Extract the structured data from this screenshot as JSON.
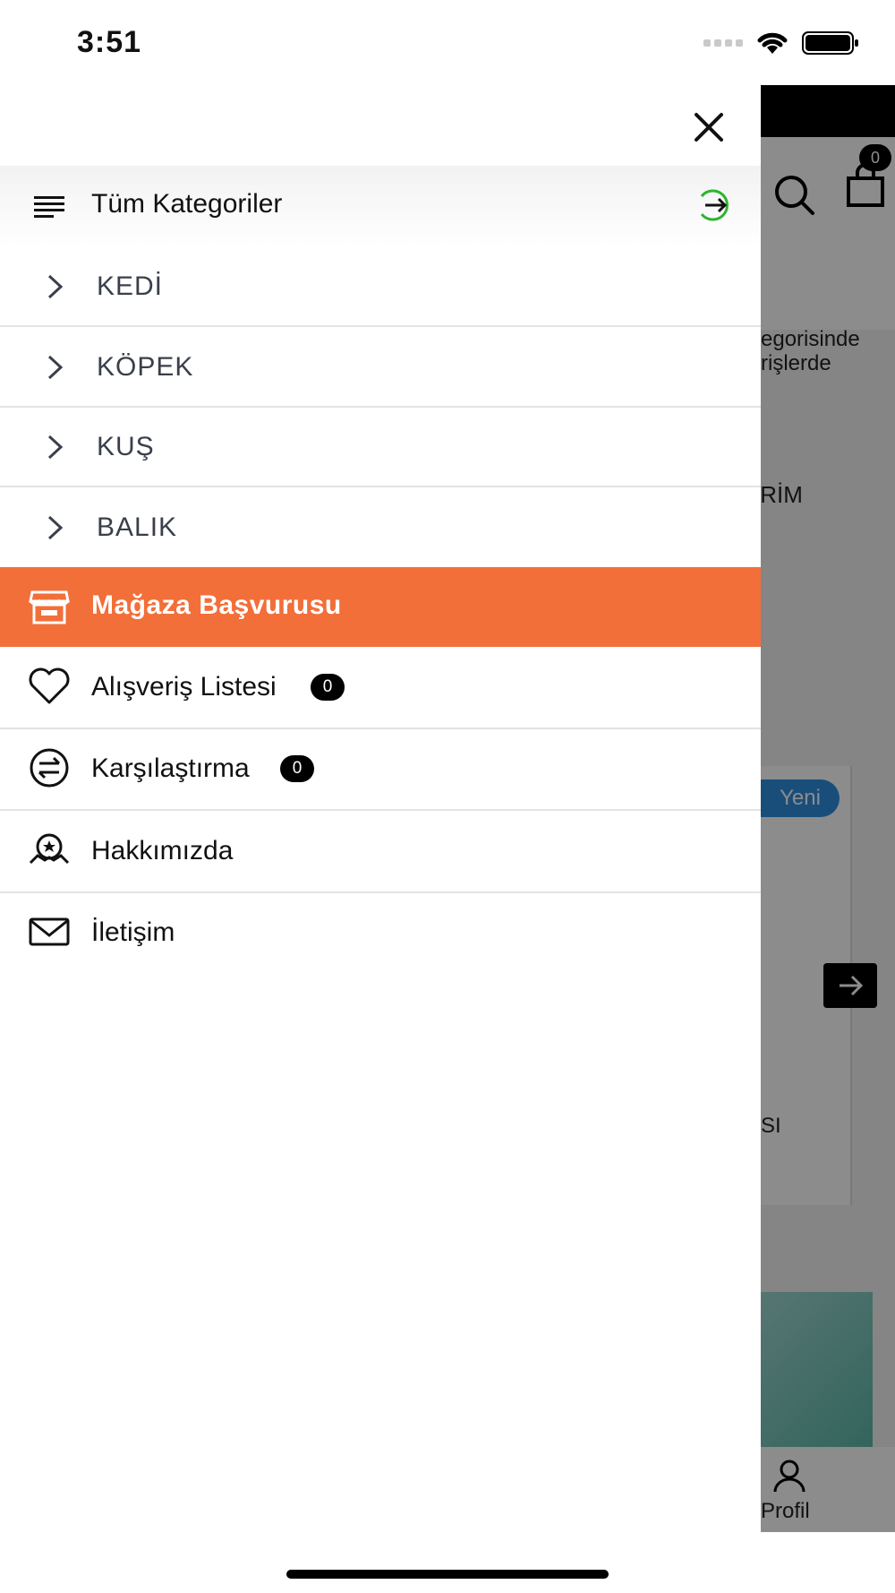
{
  "status_bar": {
    "time": "3:51"
  },
  "drawer": {
    "close_icon": "close-icon",
    "categories_header": {
      "label": "Tüm Kategoriler",
      "accent_color": "#2db52d"
    },
    "categories": [
      {
        "label": "KEDİ"
      },
      {
        "label": "KÖPEK"
      },
      {
        "label": "KUŞ"
      },
      {
        "label": "BALIK"
      }
    ],
    "store_application": {
      "label": "Mağaza Başvurusu",
      "color": "#f26f3a"
    },
    "links": [
      {
        "label": "Alışveriş Listesi",
        "count": "0",
        "icon": "heart-icon"
      },
      {
        "label": "Karşılaştırma",
        "count": "0",
        "icon": "compare-icon"
      },
      {
        "label": "Hakkımızda",
        "icon": "about-icon"
      },
      {
        "label": "İletişim",
        "icon": "mail-icon"
      }
    ]
  },
  "background_app": {
    "cart_count": "0",
    "text_fragment_1": "egorisinde",
    "text_fragment_2": "rişlerde",
    "text_fragment_3": "İRİM",
    "badge_new": "Yeni",
    "text_fragment_4": "SI",
    "nav_profile": "Profil"
  }
}
